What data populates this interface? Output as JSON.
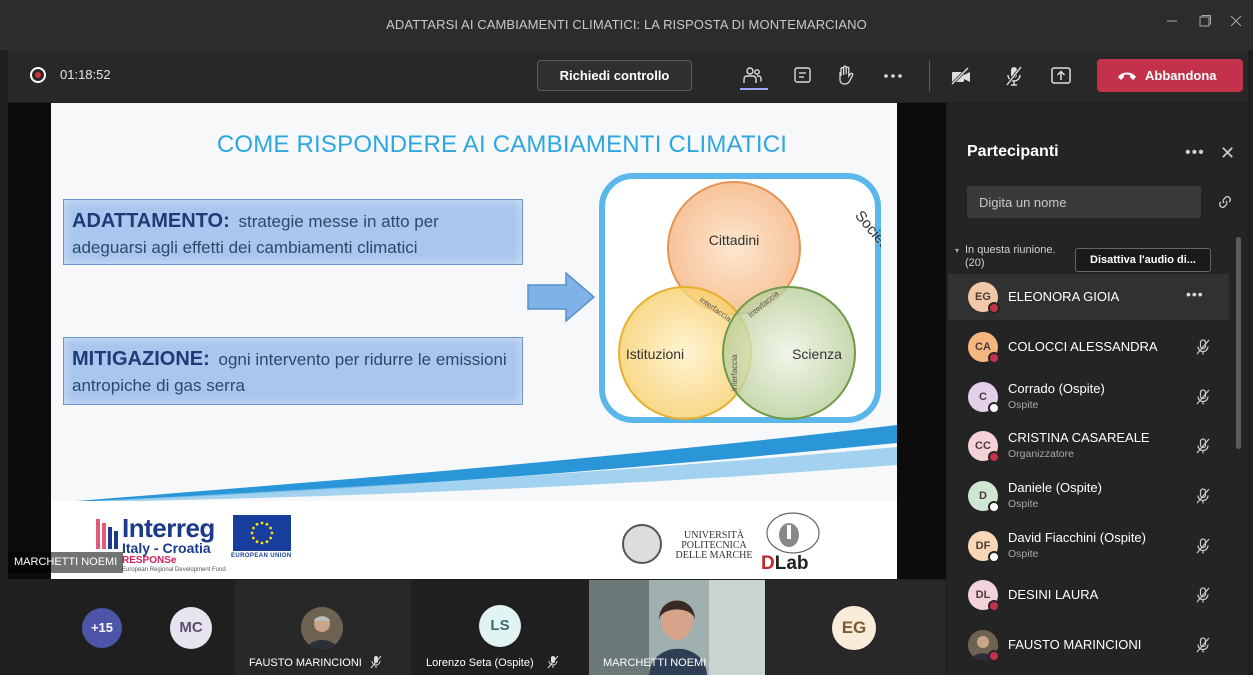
{
  "window": {
    "title": "ADATTARSI AI CAMBIAMENTI CLIMATICI: LA RISPOSTA DI MONTEMARCIANO"
  },
  "toolbar": {
    "timer": "01:18:52",
    "request_control": "Richiedi controllo",
    "leave": "Abbandona"
  },
  "slide": {
    "title": "COME RISPONDERE AI CAMBIAMENTI CLIMATICI",
    "adaptation": {
      "keyword": "ADATTAMENTO:",
      "text": "strategie messe in atto per adeguarsi agli effetti dei cambiamenti climatici"
    },
    "mitigation": {
      "keyword": "MITIGAZIONE:",
      "text": "ogni intervento per ridurre le emissioni antropiche di gas serra"
    },
    "venn": {
      "society": "Società",
      "citizens": "Cittadini",
      "institutions": "Istituzioni",
      "science": "Scienza",
      "interface": "interfaccia",
      "interface_cap": "Interfaccia"
    },
    "logos": {
      "interreg": "Interreg",
      "interreg_sub": "Italy - Croatia",
      "response": "RESPONSe",
      "erdf": "European Regional Development Fund",
      "eu": "EUROPEAN UNION",
      "university": [
        "UNIVERSITÀ",
        "POLITECNICA",
        "DELLE MARCHE"
      ],
      "dlab_d": "D",
      "dlab_lab": "Lab"
    }
  },
  "speaker_label": "MARCHETTI NOEMI",
  "gallery": {
    "more_count": "+15",
    "tiles": [
      {
        "initials": "MC"
      },
      {
        "name": "FAUSTO MARINCIONI"
      },
      {
        "initials": "LS",
        "name": "Lorenzo Seta (Ospite)"
      },
      {
        "name": "MARCHETTI NOEMI"
      },
      {
        "initials": "EG"
      }
    ]
  },
  "participants": {
    "title": "Partecipanti",
    "search_placeholder": "Digita un nome",
    "section_label": "In questa riunione. (20)",
    "tooltip": "Disattiva l'audio di...",
    "people": [
      {
        "initials": "EG",
        "name": "ELEONORA GIOIA",
        "role": "",
        "avatar_color": "#f0c8a8",
        "status_color": "#c4314b"
      },
      {
        "initials": "CA",
        "name": "COLOCCI ALESSANDRA",
        "role": "",
        "avatar_color": "#f5b67f",
        "status_color": "#c4314b"
      },
      {
        "initials": "C",
        "name": "Corrado (Ospite)",
        "role": "Ospite",
        "avatar_color": "#e2cfe8",
        "status_color": "#ffffff"
      },
      {
        "initials": "CC",
        "name": "CRISTINA CASAREALE",
        "role": "Organizzatore",
        "avatar_color": "#f4d2d8",
        "status_color": "#c4314b"
      },
      {
        "initials": "D",
        "name": "Daniele (Ospite)",
        "role": "Ospite",
        "avatar_color": "#cfe6d2",
        "status_color": "#ffffff"
      },
      {
        "initials": "DF",
        "name": "David Fiacchini (Ospite)",
        "role": "Ospite",
        "avatar_color": "#f7d7b5",
        "status_color": "#ffffff"
      },
      {
        "initials": "DL",
        "name": "DESINI LAURA",
        "role": "",
        "avatar_color": "#f2d3dc",
        "status_color": "#c4314b"
      },
      {
        "initials": "",
        "name": "FAUSTO MARINCIONI",
        "role": "",
        "avatar_color": "#6b5a4a",
        "status_color": "#c4314b"
      }
    ]
  },
  "colors": {
    "accent": "#9ea2ff",
    "leave": "#c4314b",
    "slide_title": "#2ea6e0"
  }
}
